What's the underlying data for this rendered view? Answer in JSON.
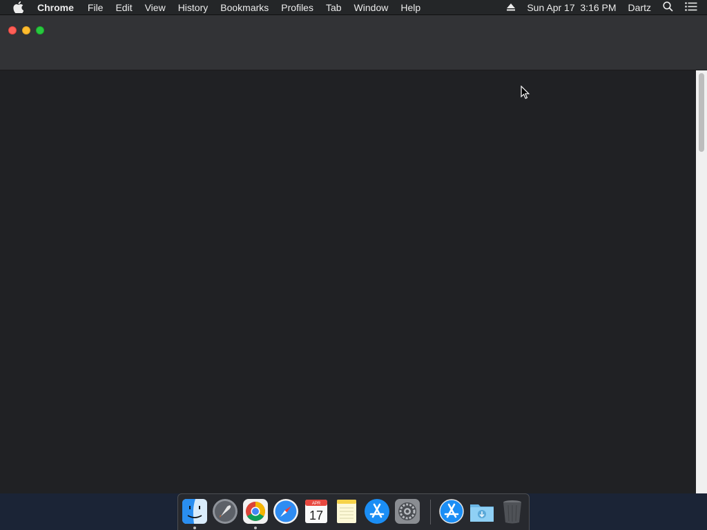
{
  "menubar": {
    "app_name": "Chrome",
    "items": [
      "File",
      "Edit",
      "View",
      "History",
      "Bookmarks",
      "Profiles",
      "Tab",
      "Window",
      "Help"
    ],
    "clock": "Sun Apr 17  3:16 PM",
    "user": "Dartz",
    "icons": [
      "apple-icon",
      "eject-icon",
      "spotlight-search-icon",
      "notification-center-icon"
    ]
  },
  "window": {
    "app": "Google Chrome",
    "buttons": [
      "close",
      "minimize",
      "zoom"
    ]
  },
  "dock": {
    "apps": [
      {
        "name": "Finder",
        "icon": "finder-icon",
        "running": true
      },
      {
        "name": "Launchpad",
        "icon": "launchpad-icon",
        "running": false
      },
      {
        "name": "Google Chrome",
        "icon": "chrome-icon",
        "running": true
      },
      {
        "name": "Safari",
        "icon": "safari-icon",
        "running": false
      },
      {
        "name": "Calendar",
        "icon": "calendar-icon",
        "running": false
      },
      {
        "name": "Notes",
        "icon": "notes-icon",
        "running": false
      },
      {
        "name": "App Store",
        "icon": "app-store-icon",
        "running": false
      },
      {
        "name": "System Preferences",
        "icon": "system-preferences-icon",
        "running": false
      },
      {
        "name": "Applications",
        "icon": "app-store-folder-icon",
        "running": false
      },
      {
        "name": "Downloads",
        "icon": "downloads-folder-icon",
        "running": false
      },
      {
        "name": "Trash",
        "icon": "trash-icon",
        "running": false
      }
    ],
    "calendar_month": "APR",
    "calendar_day": "17"
  },
  "colors": {
    "window_bg": "#202124",
    "titlebar_bg": "#323336",
    "menubar_bg": "#242628",
    "desktop_bg": "#1b2436",
    "close": "#fe5f57",
    "minimize": "#febc2e",
    "zoom": "#28c840"
  }
}
